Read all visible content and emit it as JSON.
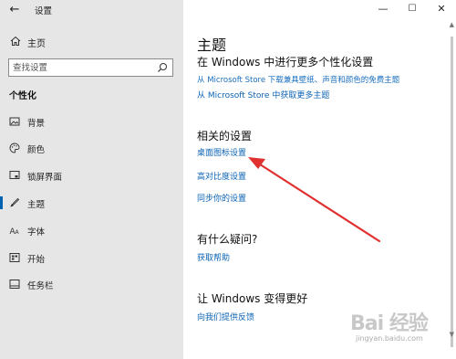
{
  "window": {
    "title": "设置",
    "controls": {
      "minimize": "—",
      "maximize": "☐",
      "close": "✕"
    }
  },
  "sidebar": {
    "home_label": "主页",
    "search_placeholder": "查找设置",
    "section_heading": "个性化",
    "items": [
      {
        "label": "背景",
        "icon": "picture-icon"
      },
      {
        "label": "颜色",
        "icon": "palette-icon"
      },
      {
        "label": "锁屏界面",
        "icon": "lock-screen-icon"
      },
      {
        "label": "主题",
        "icon": "brush-icon",
        "selected": true
      },
      {
        "label": "字体",
        "icon": "font-icon"
      },
      {
        "label": "开始",
        "icon": "start-icon"
      },
      {
        "label": "任务栏",
        "icon": "taskbar-icon"
      }
    ]
  },
  "main": {
    "title": "主题",
    "store_heading": "在 Windows 中进行更多个性化设置",
    "store_desc": "从 Microsoft Store 下载兼具壁纸、声音和颜色的免费主题",
    "store_link": "从 Microsoft Store 中获取更多主题",
    "related_heading": "相关的设置",
    "related_links": [
      "桌面图标设置",
      "高对比度设置",
      "同步你的设置"
    ],
    "question_heading": "有什么疑问?",
    "help_link": "获取帮助",
    "feedback_heading": "让 Windows 变得更好",
    "feedback_link": "向我们提供反馈"
  },
  "annotation": {
    "color": "#e03030"
  },
  "watermark": {
    "logo": "Bai 经验",
    "sub": "jingyan.baidu.com"
  },
  "colors": {
    "accent": "#0063b1",
    "link": "#0b63b5",
    "sidebar_bg": "#e6e6e6"
  }
}
